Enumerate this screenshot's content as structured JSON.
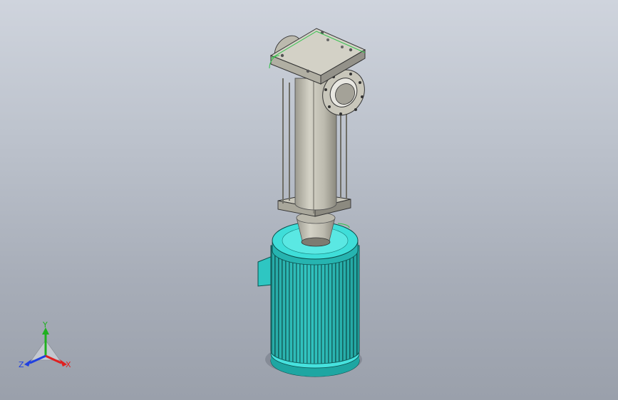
{
  "viewport": {
    "background_top": "#cfd4dd",
    "background_bottom": "#9aa0ab"
  },
  "model": {
    "name": "vertical-pump-assembly",
    "colors": {
      "casing": "#c4c2b6",
      "casing_shade": "#8f8d82",
      "motor": "#38d6d2",
      "motor_dark": "#0f6f6b",
      "edge": "#2a2a2a",
      "selection": "#2fc24a"
    }
  },
  "triad": {
    "x_label": "X",
    "y_label": "Y",
    "z_label": "Z",
    "x_color": "#e02020",
    "y_color": "#20b020",
    "z_color": "#2040e0"
  }
}
